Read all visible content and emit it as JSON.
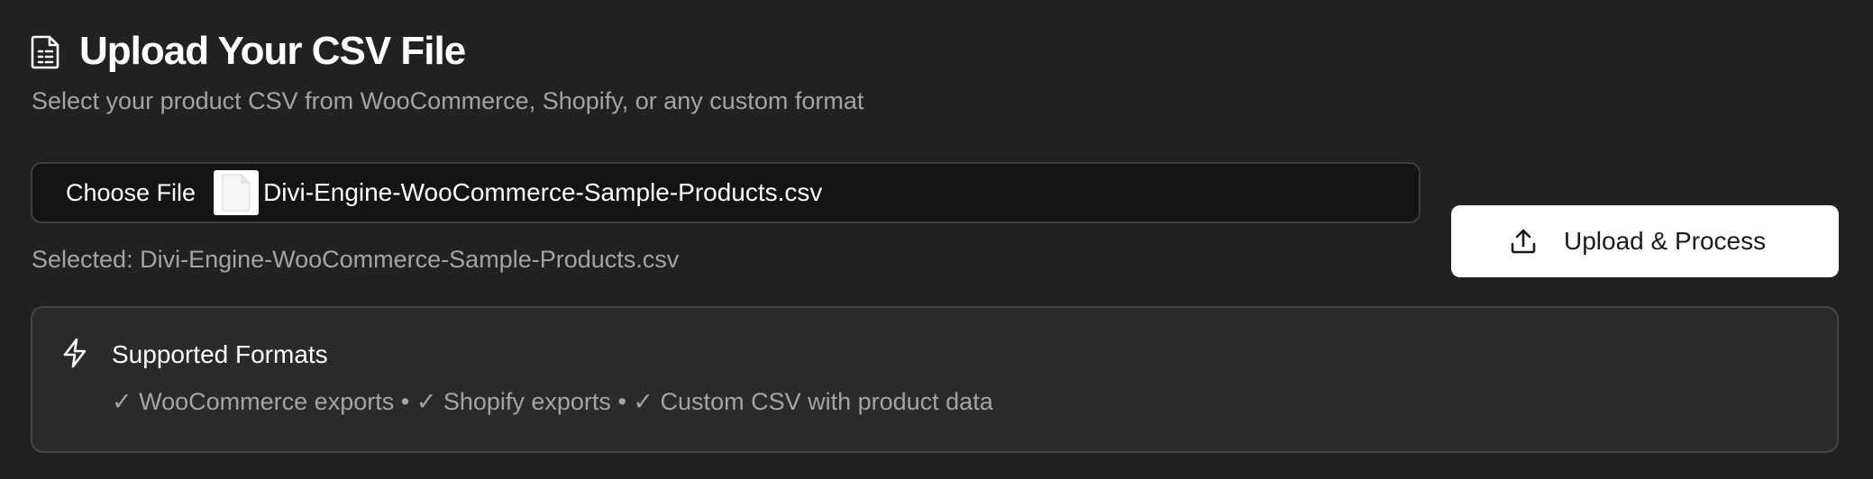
{
  "header": {
    "icon": "file-text-icon",
    "title": "Upload Your CSV File",
    "subtitle": "Select your product CSV from WooCommerce, Shopify, or any custom format"
  },
  "file_input": {
    "choose_label": "Choose File",
    "file_icon": "document-icon",
    "file_name": "Divi-Engine-WooCommerce-Sample-Products.csv",
    "selected_text": "Selected: Divi-Engine-WooCommerce-Sample-Products.csv"
  },
  "upload_button": {
    "icon": "upload-icon",
    "label": "Upload & Process"
  },
  "formats": {
    "icon": "lightning-icon",
    "title": "Supported Formats",
    "items": [
      "✓ WooCommerce exports",
      "✓ Shopify exports",
      "✓ Custom CSV with product data"
    ],
    "separator": "•"
  },
  "colors": {
    "background": "#212121",
    "card": "#2a2a2a",
    "input_bg": "#141414",
    "button_bg": "#ffffff",
    "muted_text": "#a4a4a4"
  }
}
